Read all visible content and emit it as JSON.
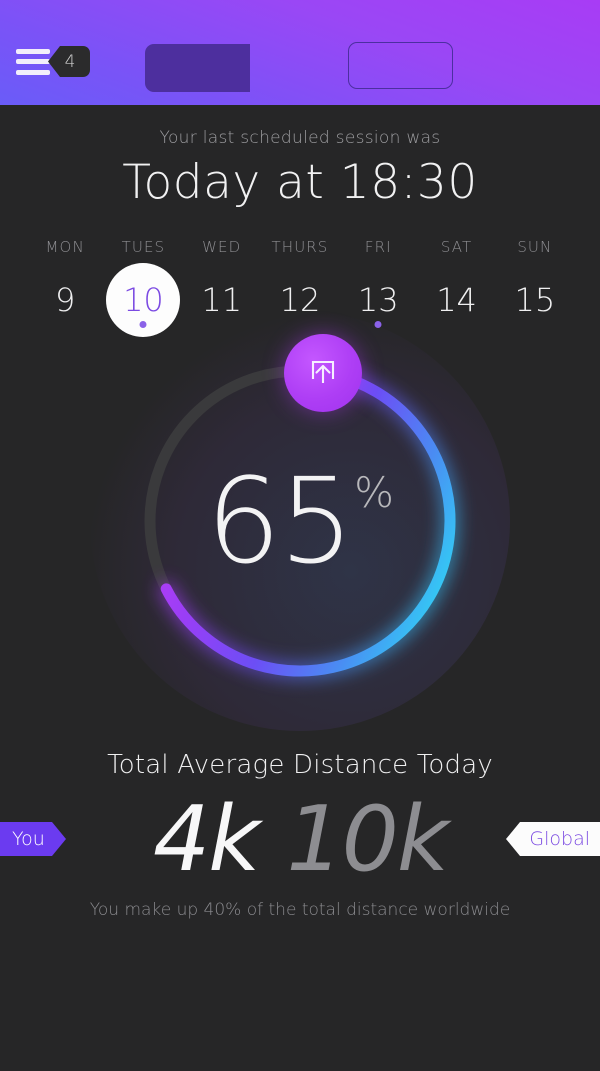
{
  "header": {
    "menu_icon": "hamburger-menu-icon",
    "badge_count": "4",
    "button_filled_label": "",
    "button_outline_label": "",
    "gradient_from": "#a83cf5",
    "gradient_to": "#6a5cf8"
  },
  "session": {
    "label": "Your last scheduled session was",
    "time": "Today at 18:30"
  },
  "week": {
    "days": [
      {
        "name": "MON",
        "date": "9",
        "selected": false,
        "dot": false
      },
      {
        "name": "TUES",
        "date": "10",
        "selected": true,
        "dot": true
      },
      {
        "name": "WED",
        "date": "11",
        "selected": false,
        "dot": false
      },
      {
        "name": "THURS",
        "date": "12",
        "selected": false,
        "dot": false
      },
      {
        "name": "FRI",
        "date": "13",
        "selected": false,
        "dot": true
      },
      {
        "name": "SAT",
        "date": "14",
        "selected": false,
        "dot": false
      },
      {
        "name": "SUN",
        "date": "15",
        "selected": false,
        "dot": false
      }
    ],
    "selected_color": "#7b4ae2",
    "dot_color": "#8b62e8"
  },
  "progress": {
    "value": "65",
    "unit": "%",
    "percent": 65,
    "track_color": "#3a3a3c",
    "gradient_start": "#c23cf7",
    "gradient_mid": "#6c4ef5",
    "gradient_end": "#35c6f4",
    "knob_icon": "upload-icon",
    "knob_color": "#ae3ef5"
  },
  "distance": {
    "title": "Total Average Distance Today",
    "you_tag": "You",
    "you_value": "4k",
    "global_value": "10k",
    "global_tag": "Global",
    "caption": "You make up 40% of the total distance worldwide",
    "you_tag_color": "#6b3bf0",
    "global_tag_color": "#7b4ae2"
  }
}
